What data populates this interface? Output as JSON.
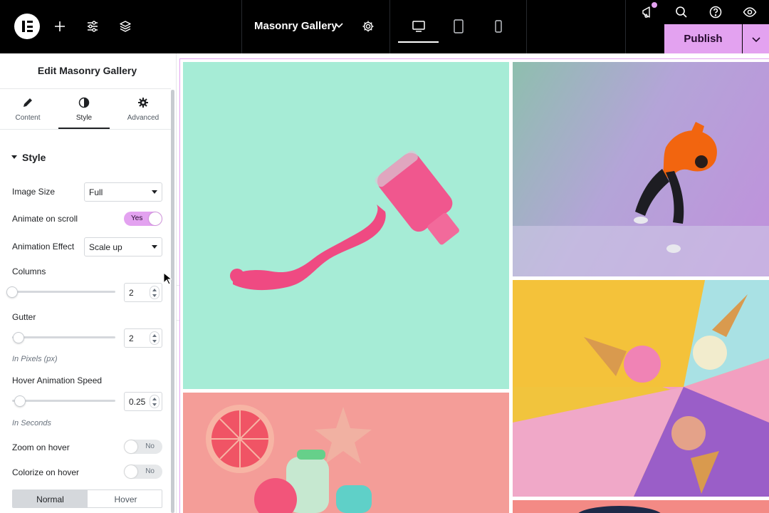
{
  "topbar": {
    "document_title": "Masonry Gallery",
    "publish_label": "Publish",
    "icons": [
      "elementor-logo-icon",
      "add-icon",
      "site-settings-icon",
      "structure-layers-icon",
      "chevron-down-icon",
      "page-settings-gear-icon",
      "desktop-icon",
      "tablet-icon",
      "mobile-icon",
      "announcements-icon",
      "search-icon",
      "help-icon",
      "preview-eye-icon"
    ],
    "accent_color": "#e3a2f0"
  },
  "panel": {
    "title": "Edit Masonry Gallery",
    "tabs": [
      {
        "label": "Content",
        "icon": "pencil-icon"
      },
      {
        "label": "Style",
        "icon": "half-circle-icon"
      },
      {
        "label": "Advanced",
        "icon": "gear-icon"
      }
    ],
    "active_tab": "Style",
    "section_title": "Style",
    "controls": {
      "image_size": {
        "label": "Image Size",
        "value": "Full"
      },
      "animate_on_scroll": {
        "label": "Animate on scroll",
        "value": "Yes"
      },
      "animation_effect": {
        "label": "Animation Effect",
        "value": "Scale up"
      },
      "columns": {
        "label": "Columns",
        "value": "2"
      },
      "gutter": {
        "label": "Gutter",
        "value": "2",
        "hint": "In Pixels (px)"
      },
      "hover_speed": {
        "label": "Hover Animation Speed",
        "value": "0.25",
        "hint": "In Seconds"
      },
      "zoom_on_hover": {
        "label": "Zoom on hover",
        "value": "No"
      },
      "colorize_on_hover": {
        "label": "Colorize on hover",
        "value": "No"
      }
    },
    "state_tabs": [
      "Normal",
      "Hover"
    ],
    "active_state": "Normal"
  },
  "gallery": {
    "images": [
      "nail-polish-spill-image",
      "dancer-orange-hoodie-image",
      "ice-cream-cones-image",
      "grapefruit-starfish-popsicles-image",
      "partial-image"
    ]
  }
}
